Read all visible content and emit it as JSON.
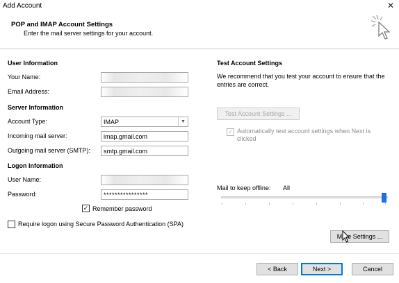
{
  "window": {
    "title": "Add Account",
    "close_label": "✕"
  },
  "header": {
    "title": "POP and IMAP Account Settings",
    "subtitle": "Enter the mail server settings for your account."
  },
  "user_info": {
    "title": "User Information",
    "your_name_label": "Your Name:",
    "your_name_value": "",
    "email_label": "Email Address:",
    "email_value": ""
  },
  "server_info": {
    "title": "Server Information",
    "account_type_label": "Account Type:",
    "account_type_value": "IMAP",
    "incoming_label": "Incoming mail server:",
    "incoming_value": "imap.gmail.com",
    "outgoing_label": "Outgoing mail server (SMTP):",
    "outgoing_value": "smtp.gmail.com"
  },
  "logon_info": {
    "title": "Logon Information",
    "username_label": "User Name:",
    "username_value": "",
    "password_label": "Password:",
    "password_value": "****************",
    "remember_label": "Remember password",
    "remember_checked": true,
    "spa_label": "Require logon using Secure Password Authentication (SPA)",
    "spa_checked": false
  },
  "test_settings": {
    "title": "Test Account Settings",
    "description": "We recommend that you test your account to ensure that the entries are correct.",
    "test_button": "Test Account Settings ...",
    "auto_test_label": "Automatically test account settings when Next is clicked",
    "auto_test_checked": true
  },
  "offline": {
    "label": "Mail to keep offline:",
    "value": "All",
    "level": 1.0
  },
  "more_settings_button": "More Settings ...",
  "footer": {
    "back_button": "< Back",
    "next_button": "Next >",
    "cancel_button": "Cancel"
  },
  "colors": {
    "accent": "#0078d7",
    "slider": "#1f6ee8"
  }
}
